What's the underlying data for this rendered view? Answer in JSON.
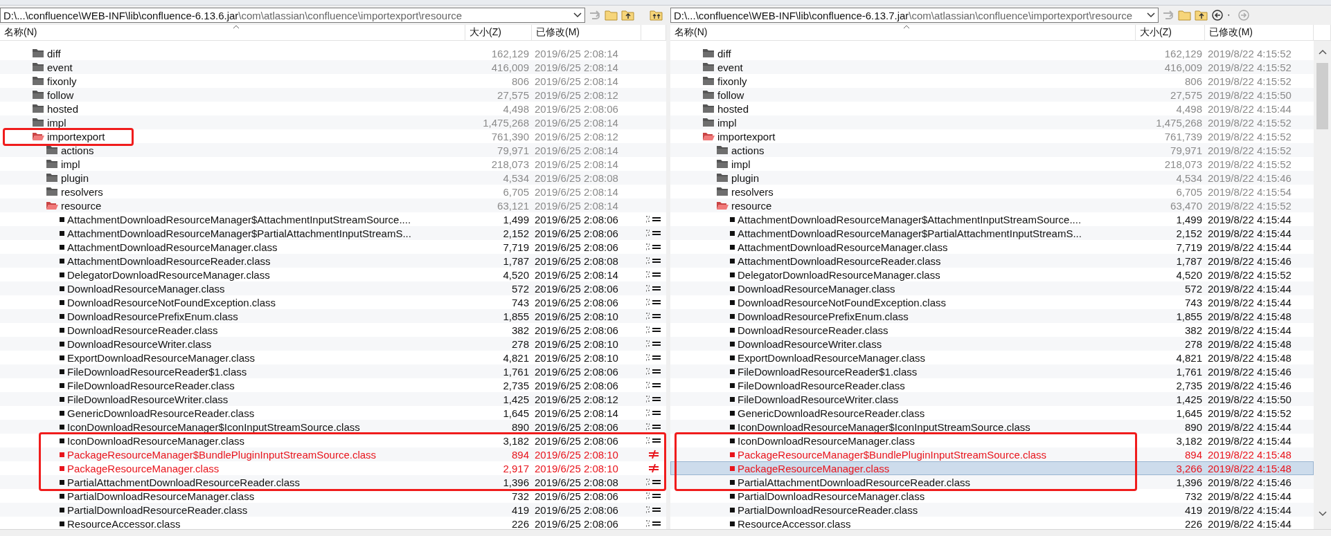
{
  "panes": [
    {
      "path_main": "D:\\...\\confluence\\WEB-INF\\lib\\confluence-6.13.6.jar",
      "path_rest": "\\com\\atlassian\\confluence\\importexport\\resource",
      "columns": [
        "名称(N)",
        "大小(Z)",
        "已修改(M)"
      ],
      "tree": [
        {
          "kind": "folder",
          "name": "diff",
          "size": "162,129",
          "modified": "2019/6/25 2:08:14",
          "different": false,
          "expanded": false,
          "selected": false,
          "framed": false
        },
        {
          "kind": "folder",
          "name": "event",
          "size": "416,009",
          "modified": "2019/6/25 2:08:14",
          "different": false,
          "expanded": false,
          "selected": false,
          "framed": false
        },
        {
          "kind": "folder",
          "name": "fixonly",
          "size": "806",
          "modified": "2019/6/25 2:08:14",
          "different": false,
          "expanded": false,
          "selected": false,
          "framed": false
        },
        {
          "kind": "folder",
          "name": "follow",
          "size": "27,575",
          "modified": "2019/6/25 2:08:12",
          "different": false,
          "expanded": false,
          "selected": false,
          "framed": false
        },
        {
          "kind": "folder",
          "name": "hosted",
          "size": "4,498",
          "modified": "2019/6/25 2:08:06",
          "different": false,
          "expanded": false,
          "selected": false,
          "framed": false
        },
        {
          "kind": "folder",
          "name": "impl",
          "size": "1,475,268",
          "modified": "2019/6/25 2:08:14",
          "different": false,
          "expanded": false,
          "selected": false,
          "framed": false
        },
        {
          "kind": "folder",
          "name": "importexport",
          "size": "761,390",
          "modified": "2019/6/25 2:08:12",
          "different": true,
          "expanded": true,
          "selected": false,
          "framed": true,
          "children": [
            {
              "kind": "folder",
              "name": "actions",
              "size": "79,971",
              "modified": "2019/6/25 2:08:14",
              "different": false,
              "expanded": false,
              "selected": false,
              "framed": false
            },
            {
              "kind": "folder",
              "name": "impl",
              "size": "218,073",
              "modified": "2019/6/25 2:08:14",
              "different": false,
              "expanded": false,
              "selected": false,
              "framed": false
            },
            {
              "kind": "folder",
              "name": "plugin",
              "size": "4,534",
              "modified": "2019/6/25 2:08:08",
              "different": false,
              "expanded": false,
              "selected": false,
              "framed": false
            },
            {
              "kind": "folder",
              "name": "resolvers",
              "size": "6,705",
              "modified": "2019/6/25 2:08:14",
              "different": false,
              "expanded": false,
              "selected": false,
              "framed": false
            },
            {
              "kind": "folder",
              "name": "resource",
              "size": "63,121",
              "modified": "2019/6/25 2:08:14",
              "different": true,
              "expanded": true,
              "selected": false,
              "framed": false,
              "children": [
                {
                  "kind": "file",
                  "name": "AttachmentDownloadResourceManager$AttachmentInputStreamSource....",
                  "size": "1,499",
                  "modified": "2019/6/25 2:08:06",
                  "different": false,
                  "selected": false,
                  "framed": false
                },
                {
                  "kind": "file",
                  "name": "AttachmentDownloadResourceManager$PartialAttachmentInputStreamS...",
                  "size": "2,152",
                  "modified": "2019/6/25 2:08:06",
                  "different": false,
                  "selected": false,
                  "framed": false
                },
                {
                  "kind": "file",
                  "name": "AttachmentDownloadResourceManager.class",
                  "size": "7,719",
                  "modified": "2019/6/25 2:08:06",
                  "different": false,
                  "selected": false,
                  "framed": false
                },
                {
                  "kind": "file",
                  "name": "AttachmentDownloadResourceReader.class",
                  "size": "1,787",
                  "modified": "2019/6/25 2:08:08",
                  "different": false,
                  "selected": false,
                  "framed": false
                },
                {
                  "kind": "file",
                  "name": "DelegatorDownloadResourceManager.class",
                  "size": "4,520",
                  "modified": "2019/6/25 2:08:14",
                  "different": false,
                  "selected": false,
                  "framed": false
                },
                {
                  "kind": "file",
                  "name": "DownloadResourceManager.class",
                  "size": "572",
                  "modified": "2019/6/25 2:08:06",
                  "different": false,
                  "selected": false,
                  "framed": false
                },
                {
                  "kind": "file",
                  "name": "DownloadResourceNotFoundException.class",
                  "size": "743",
                  "modified": "2019/6/25 2:08:06",
                  "different": false,
                  "selected": false,
                  "framed": false
                },
                {
                  "kind": "file",
                  "name": "DownloadResourcePrefixEnum.class",
                  "size": "1,855",
                  "modified": "2019/6/25 2:08:10",
                  "different": false,
                  "selected": false,
                  "framed": false
                },
                {
                  "kind": "file",
                  "name": "DownloadResourceReader.class",
                  "size": "382",
                  "modified": "2019/6/25 2:08:06",
                  "different": false,
                  "selected": false,
                  "framed": false
                },
                {
                  "kind": "file",
                  "name": "DownloadResourceWriter.class",
                  "size": "278",
                  "modified": "2019/6/25 2:08:10",
                  "different": false,
                  "selected": false,
                  "framed": false
                },
                {
                  "kind": "file",
                  "name": "ExportDownloadResourceManager.class",
                  "size": "4,821",
                  "modified": "2019/6/25 2:08:10",
                  "different": false,
                  "selected": false,
                  "framed": false
                },
                {
                  "kind": "file",
                  "name": "FileDownloadResourceReader$1.class",
                  "size": "1,761",
                  "modified": "2019/6/25 2:08:06",
                  "different": false,
                  "selected": false,
                  "framed": false
                },
                {
                  "kind": "file",
                  "name": "FileDownloadResourceReader.class",
                  "size": "2,735",
                  "modified": "2019/6/25 2:08:06",
                  "different": false,
                  "selected": false,
                  "framed": false
                },
                {
                  "kind": "file",
                  "name": "FileDownloadResourceWriter.class",
                  "size": "1,425",
                  "modified": "2019/6/25 2:08:12",
                  "different": false,
                  "selected": false,
                  "framed": false
                },
                {
                  "kind": "file",
                  "name": "GenericDownloadResourceReader.class",
                  "size": "1,645",
                  "modified": "2019/6/25 2:08:14",
                  "different": false,
                  "selected": false,
                  "framed": false
                },
                {
                  "kind": "file",
                  "name": "IconDownloadResourceManager$IconInputStreamSource.class",
                  "size": "890",
                  "modified": "2019/6/25 2:08:06",
                  "different": false,
                  "selected": false,
                  "framed": false
                },
                {
                  "kind": "file",
                  "name": "IconDownloadResourceManager.class",
                  "size": "3,182",
                  "modified": "2019/6/25 2:08:06",
                  "different": false,
                  "selected": false,
                  "framed": true
                },
                {
                  "kind": "file",
                  "name": "PackageResourceManager$BundlePluginInputStreamSource.class",
                  "size": "894",
                  "modified": "2019/6/25 2:08:10",
                  "different": true,
                  "selected": false,
                  "framed": true
                },
                {
                  "kind": "file",
                  "name": "PackageResourceManager.class",
                  "size": "2,917",
                  "modified": "2019/6/25 2:08:10",
                  "different": true,
                  "selected": false,
                  "framed": true
                },
                {
                  "kind": "file",
                  "name": "PartialAttachmentDownloadResourceReader.class",
                  "size": "1,396",
                  "modified": "2019/6/25 2:08:08",
                  "different": false,
                  "selected": false,
                  "framed": true
                },
                {
                  "kind": "file",
                  "name": "PartialDownloadResourceManager.class",
                  "size": "732",
                  "modified": "2019/6/25 2:08:06",
                  "different": false,
                  "selected": false,
                  "framed": false
                },
                {
                  "kind": "file",
                  "name": "PartialDownloadResourceReader.class",
                  "size": "419",
                  "modified": "2019/6/25 2:08:06",
                  "different": false,
                  "selected": false,
                  "framed": false
                },
                {
                  "kind": "file",
                  "name": "ResourceAccessor.class",
                  "size": "226",
                  "modified": "2019/6/25 2:08:06",
                  "different": false,
                  "selected": false,
                  "framed": false
                }
              ]
            }
          ]
        }
      ]
    },
    {
      "path_main": "D:\\...\\confluence\\WEB-INF\\lib\\confluence-6.13.7.jar",
      "path_rest": "\\com\\atlassian\\confluence\\importexport\\resource",
      "columns": [
        "名称(N)",
        "大小(Z)",
        "已修改(M)"
      ],
      "tree": [
        {
          "kind": "folder",
          "name": "diff",
          "size": "162,129",
          "modified": "2019/8/22 4:15:52",
          "different": false,
          "expanded": false,
          "selected": false,
          "framed": false
        },
        {
          "kind": "folder",
          "name": "event",
          "size": "416,009",
          "modified": "2019/8/22 4:15:52",
          "different": false,
          "expanded": false,
          "selected": false,
          "framed": false
        },
        {
          "kind": "folder",
          "name": "fixonly",
          "size": "806",
          "modified": "2019/8/22 4:15:52",
          "different": false,
          "expanded": false,
          "selected": false,
          "framed": false
        },
        {
          "kind": "folder",
          "name": "follow",
          "size": "27,575",
          "modified": "2019/8/22 4:15:50",
          "different": false,
          "expanded": false,
          "selected": false,
          "framed": false
        },
        {
          "kind": "folder",
          "name": "hosted",
          "size": "4,498",
          "modified": "2019/8/22 4:15:44",
          "different": false,
          "expanded": false,
          "selected": false,
          "framed": false
        },
        {
          "kind": "folder",
          "name": "impl",
          "size": "1,475,268",
          "modified": "2019/8/22 4:15:52",
          "different": false,
          "expanded": false,
          "selected": false,
          "framed": false
        },
        {
          "kind": "folder",
          "name": "importexport",
          "size": "761,739",
          "modified": "2019/8/22 4:15:52",
          "different": true,
          "expanded": true,
          "selected": false,
          "framed": false,
          "children": [
            {
              "kind": "folder",
              "name": "actions",
              "size": "79,971",
              "modified": "2019/8/22 4:15:52",
              "different": false,
              "expanded": false,
              "selected": false,
              "framed": false
            },
            {
              "kind": "folder",
              "name": "impl",
              "size": "218,073",
              "modified": "2019/8/22 4:15:52",
              "different": false,
              "expanded": false,
              "selected": false,
              "framed": false
            },
            {
              "kind": "folder",
              "name": "plugin",
              "size": "4,534",
              "modified": "2019/8/22 4:15:46",
              "different": false,
              "expanded": false,
              "selected": false,
              "framed": false
            },
            {
              "kind": "folder",
              "name": "resolvers",
              "size": "6,705",
              "modified": "2019/8/22 4:15:54",
              "different": false,
              "expanded": false,
              "selected": false,
              "framed": false
            },
            {
              "kind": "folder",
              "name": "resource",
              "size": "63,470",
              "modified": "2019/8/22 4:15:52",
              "different": true,
              "expanded": true,
              "selected": false,
              "framed": false,
              "children": [
                {
                  "kind": "file",
                  "name": "AttachmentDownloadResourceManager$AttachmentInputStreamSource....",
                  "size": "1,499",
                  "modified": "2019/8/22 4:15:44",
                  "different": false,
                  "selected": false,
                  "framed": false
                },
                {
                  "kind": "file",
                  "name": "AttachmentDownloadResourceManager$PartialAttachmentInputStreamS...",
                  "size": "2,152",
                  "modified": "2019/8/22 4:15:44",
                  "different": false,
                  "selected": false,
                  "framed": false
                },
                {
                  "kind": "file",
                  "name": "AttachmentDownloadResourceManager.class",
                  "size": "7,719",
                  "modified": "2019/8/22 4:15:44",
                  "different": false,
                  "selected": false,
                  "framed": false
                },
                {
                  "kind": "file",
                  "name": "AttachmentDownloadResourceReader.class",
                  "size": "1,787",
                  "modified": "2019/8/22 4:15:46",
                  "different": false,
                  "selected": false,
                  "framed": false
                },
                {
                  "kind": "file",
                  "name": "DelegatorDownloadResourceManager.class",
                  "size": "4,520",
                  "modified": "2019/8/22 4:15:52",
                  "different": false,
                  "selected": false,
                  "framed": false
                },
                {
                  "kind": "file",
                  "name": "DownloadResourceManager.class",
                  "size": "572",
                  "modified": "2019/8/22 4:15:44",
                  "different": false,
                  "selected": false,
                  "framed": false
                },
                {
                  "kind": "file",
                  "name": "DownloadResourceNotFoundException.class",
                  "size": "743",
                  "modified": "2019/8/22 4:15:44",
                  "different": false,
                  "selected": false,
                  "framed": false
                },
                {
                  "kind": "file",
                  "name": "DownloadResourcePrefixEnum.class",
                  "size": "1,855",
                  "modified": "2019/8/22 4:15:48",
                  "different": false,
                  "selected": false,
                  "framed": false
                },
                {
                  "kind": "file",
                  "name": "DownloadResourceReader.class",
                  "size": "382",
                  "modified": "2019/8/22 4:15:44",
                  "different": false,
                  "selected": false,
                  "framed": false
                },
                {
                  "kind": "file",
                  "name": "DownloadResourceWriter.class",
                  "size": "278",
                  "modified": "2019/8/22 4:15:48",
                  "different": false,
                  "selected": false,
                  "framed": false
                },
                {
                  "kind": "file",
                  "name": "ExportDownloadResourceManager.class",
                  "size": "4,821",
                  "modified": "2019/8/22 4:15:48",
                  "different": false,
                  "selected": false,
                  "framed": false
                },
                {
                  "kind": "file",
                  "name": "FileDownloadResourceReader$1.class",
                  "size": "1,761",
                  "modified": "2019/8/22 4:15:46",
                  "different": false,
                  "selected": false,
                  "framed": false
                },
                {
                  "kind": "file",
                  "name": "FileDownloadResourceReader.class",
                  "size": "2,735",
                  "modified": "2019/8/22 4:15:46",
                  "different": false,
                  "selected": false,
                  "framed": false
                },
                {
                  "kind": "file",
                  "name": "FileDownloadResourceWriter.class",
                  "size": "1,425",
                  "modified": "2019/8/22 4:15:50",
                  "different": false,
                  "selected": false,
                  "framed": false
                },
                {
                  "kind": "file",
                  "name": "GenericDownloadResourceReader.class",
                  "size": "1,645",
                  "modified": "2019/8/22 4:15:52",
                  "different": false,
                  "selected": false,
                  "framed": false
                },
                {
                  "kind": "file",
                  "name": "IconDownloadResourceManager$IconInputStreamSource.class",
                  "size": "890",
                  "modified": "2019/8/22 4:15:44",
                  "different": false,
                  "selected": false,
                  "framed": false
                },
                {
                  "kind": "file",
                  "name": "IconDownloadResourceManager.class",
                  "size": "3,182",
                  "modified": "2019/8/22 4:15:44",
                  "different": false,
                  "selected": false,
                  "framed": true
                },
                {
                  "kind": "file",
                  "name": "PackageResourceManager$BundlePluginInputStreamSource.class",
                  "size": "894",
                  "modified": "2019/8/22 4:15:48",
                  "different": true,
                  "selected": false,
                  "framed": true
                },
                {
                  "kind": "file",
                  "name": "PackageResourceManager.class",
                  "size": "3,266",
                  "modified": "2019/8/22 4:15:48",
                  "different": true,
                  "selected": true,
                  "framed": true
                },
                {
                  "kind": "file",
                  "name": "PartialAttachmentDownloadResourceReader.class",
                  "size": "1,396",
                  "modified": "2019/8/22 4:15:46",
                  "different": false,
                  "selected": false,
                  "framed": true
                },
                {
                  "kind": "file",
                  "name": "PartialDownloadResourceManager.class",
                  "size": "732",
                  "modified": "2019/8/22 4:15:44",
                  "different": false,
                  "selected": false,
                  "framed": false
                },
                {
                  "kind": "file",
                  "name": "PartialDownloadResourceReader.class",
                  "size": "419",
                  "modified": "2019/8/22 4:15:44",
                  "different": false,
                  "selected": false,
                  "framed": false
                },
                {
                  "kind": "file",
                  "name": "ResourceAccessor.class",
                  "size": "226",
                  "modified": "2019/8/22 4:15:44",
                  "different": false,
                  "selected": false,
                  "framed": false
                }
              ]
            }
          ]
        }
      ]
    }
  ]
}
